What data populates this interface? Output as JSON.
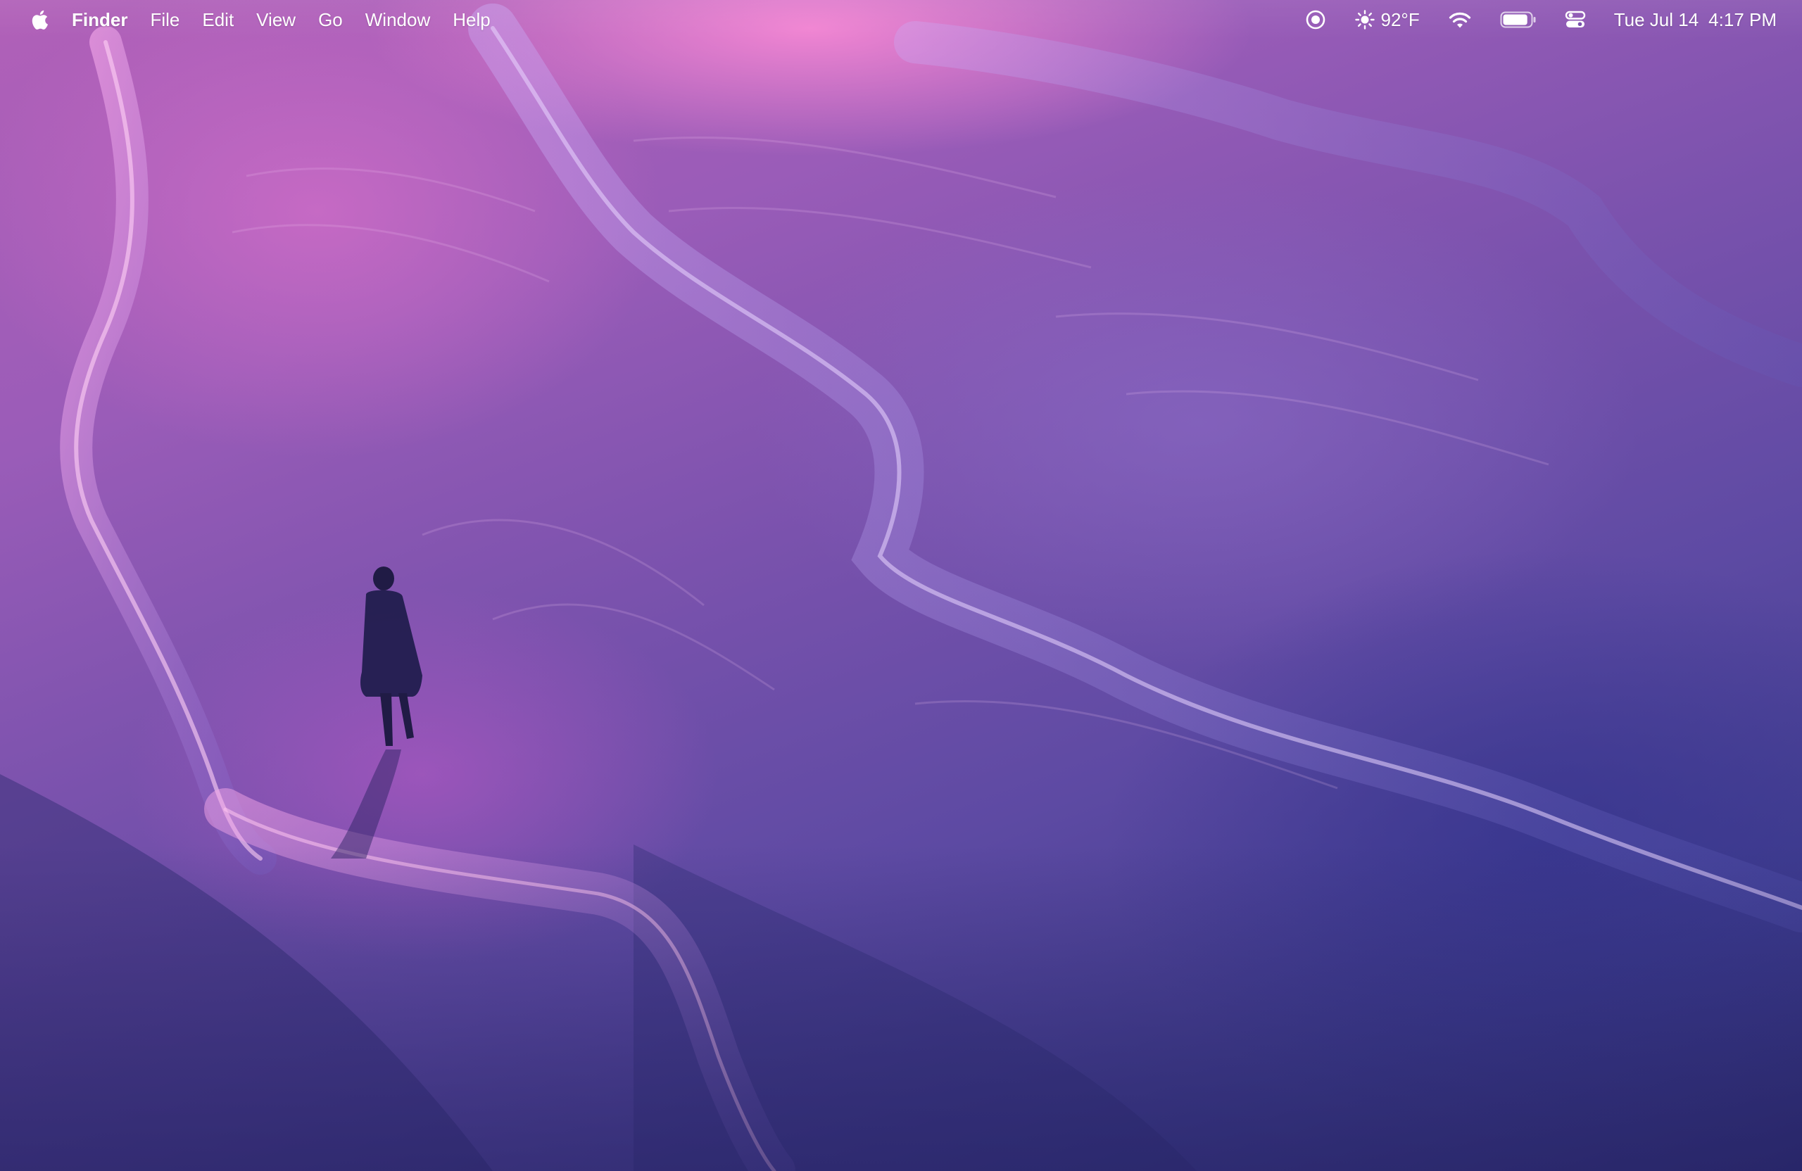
{
  "menubar": {
    "apple_icon": "apple-logo-icon",
    "app_name": "Finder",
    "menus": [
      "File",
      "Edit",
      "View",
      "Go",
      "Window",
      "Help"
    ],
    "status": {
      "screen_record_icon": "record-icon",
      "weather_icon": "sun-icon",
      "temperature": "92°F",
      "wifi_icon": "wifi-icon",
      "battery_icon": "battery-icon",
      "battery_level": 0.9,
      "control_center_icon": "control-center-icon",
      "date": "Tue Jul 14",
      "time": "4:17 PM"
    }
  },
  "wallpaper": {
    "description_colors": {
      "highlight_pink": "#f07bd6",
      "mid_purple": "#8a55b6",
      "deep_indigo": "#2f2f77"
    }
  }
}
